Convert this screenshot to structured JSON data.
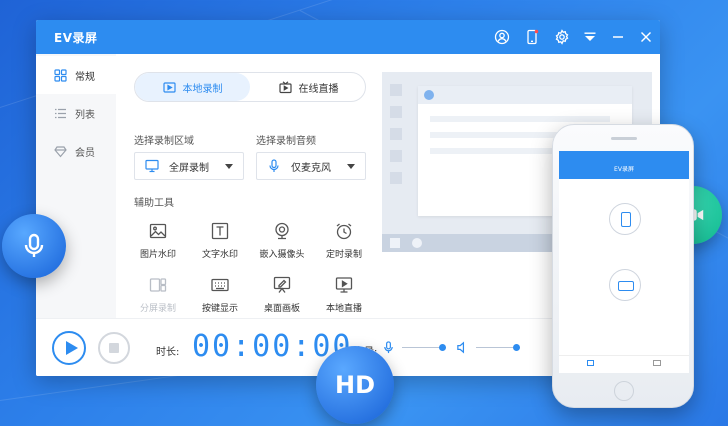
{
  "app": {
    "title": "EV录屏",
    "accent_color": "#2d8cf0",
    "titlebar_icons": [
      "user-icon",
      "phone-icon",
      "gear-icon",
      "dropdown-menu-icon",
      "minimize-icon",
      "close-icon"
    ]
  },
  "sidebar": {
    "items": [
      {
        "label": "常规",
        "icon": "grid-icon",
        "active": true
      },
      {
        "label": "列表",
        "icon": "list-icon",
        "active": false
      },
      {
        "label": "会员",
        "icon": "diamond-icon",
        "active": false
      }
    ]
  },
  "tabs": [
    {
      "label": "本地录制",
      "icon": "local-record-icon",
      "active": true
    },
    {
      "label": "在线直播",
      "icon": "live-tv-icon",
      "active": false
    }
  ],
  "record_area": {
    "label": "选择录制区域",
    "value": "全屏录制"
  },
  "record_audio": {
    "label": "选择录制音频",
    "value": "仅麦克风"
  },
  "tools": {
    "label": "辅助工具",
    "items": [
      {
        "label": "图片水印",
        "icon": "image-icon",
        "enabled": true
      },
      {
        "label": "文字水印",
        "icon": "text-icon",
        "enabled": true
      },
      {
        "label": "嵌入摄像头",
        "icon": "webcam-icon",
        "enabled": true
      },
      {
        "label": "定时录制",
        "icon": "alarm-clock-icon",
        "enabled": true
      },
      {
        "label": "分屏录制",
        "icon": "split-screen-icon",
        "enabled": false
      },
      {
        "label": "按键显示",
        "icon": "keyboard-icon",
        "enabled": true
      },
      {
        "label": "桌面画板",
        "icon": "drawing-board-icon",
        "enabled": true
      },
      {
        "label": "本地直播",
        "icon": "monitor-play-icon",
        "enabled": true
      }
    ]
  },
  "bottom": {
    "duration_label": "时长:",
    "timer": "00:00:00",
    "volume_label": "音量:",
    "mic_volume": 0.9,
    "speaker_volume": 0.9
  },
  "decor": {
    "hd_text": "HD",
    "phone_title": "EV录屏"
  }
}
